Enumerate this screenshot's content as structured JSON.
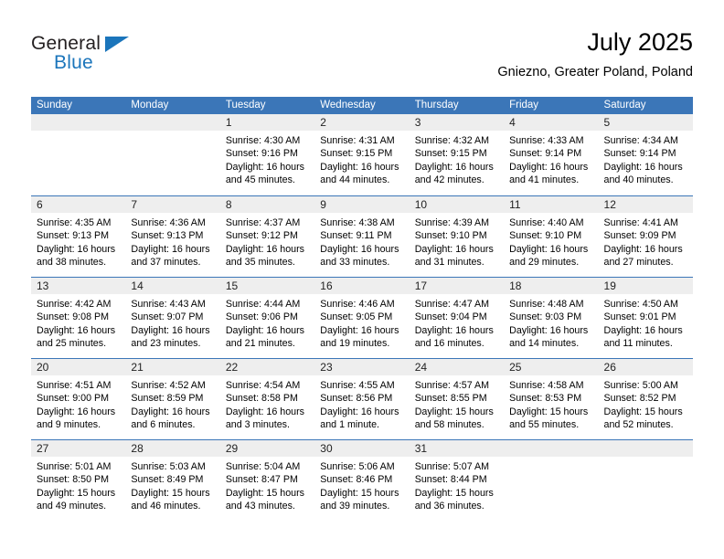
{
  "brand": {
    "name_part1": "General",
    "name_part2": "Blue",
    "logo_icon": "triangle-flag-icon",
    "accent_color": "#1b75bb"
  },
  "header": {
    "title": "July 2025",
    "subtitle": "Gniezno, Greater Poland, Poland"
  },
  "calendar": {
    "header_bg": "#3b76b8",
    "day_band_bg": "#eeeeee",
    "weekday_headers": [
      "Sunday",
      "Monday",
      "Tuesday",
      "Wednesday",
      "Thursday",
      "Friday",
      "Saturday"
    ],
    "weeks": [
      [
        {
          "day": "",
          "lines": []
        },
        {
          "day": "",
          "lines": []
        },
        {
          "day": "1",
          "lines": [
            "Sunrise: 4:30 AM",
            "Sunset: 9:16 PM",
            "Daylight: 16 hours",
            "and 45 minutes."
          ]
        },
        {
          "day": "2",
          "lines": [
            "Sunrise: 4:31 AM",
            "Sunset: 9:15 PM",
            "Daylight: 16 hours",
            "and 44 minutes."
          ]
        },
        {
          "day": "3",
          "lines": [
            "Sunrise: 4:32 AM",
            "Sunset: 9:15 PM",
            "Daylight: 16 hours",
            "and 42 minutes."
          ]
        },
        {
          "day": "4",
          "lines": [
            "Sunrise: 4:33 AM",
            "Sunset: 9:14 PM",
            "Daylight: 16 hours",
            "and 41 minutes."
          ]
        },
        {
          "day": "5",
          "lines": [
            "Sunrise: 4:34 AM",
            "Sunset: 9:14 PM",
            "Daylight: 16 hours",
            "and 40 minutes."
          ]
        }
      ],
      [
        {
          "day": "6",
          "lines": [
            "Sunrise: 4:35 AM",
            "Sunset: 9:13 PM",
            "Daylight: 16 hours",
            "and 38 minutes."
          ]
        },
        {
          "day": "7",
          "lines": [
            "Sunrise: 4:36 AM",
            "Sunset: 9:13 PM",
            "Daylight: 16 hours",
            "and 37 minutes."
          ]
        },
        {
          "day": "8",
          "lines": [
            "Sunrise: 4:37 AM",
            "Sunset: 9:12 PM",
            "Daylight: 16 hours",
            "and 35 minutes."
          ]
        },
        {
          "day": "9",
          "lines": [
            "Sunrise: 4:38 AM",
            "Sunset: 9:11 PM",
            "Daylight: 16 hours",
            "and 33 minutes."
          ]
        },
        {
          "day": "10",
          "lines": [
            "Sunrise: 4:39 AM",
            "Sunset: 9:10 PM",
            "Daylight: 16 hours",
            "and 31 minutes."
          ]
        },
        {
          "day": "11",
          "lines": [
            "Sunrise: 4:40 AM",
            "Sunset: 9:10 PM",
            "Daylight: 16 hours",
            "and 29 minutes."
          ]
        },
        {
          "day": "12",
          "lines": [
            "Sunrise: 4:41 AM",
            "Sunset: 9:09 PM",
            "Daylight: 16 hours",
            "and 27 minutes."
          ]
        }
      ],
      [
        {
          "day": "13",
          "lines": [
            "Sunrise: 4:42 AM",
            "Sunset: 9:08 PM",
            "Daylight: 16 hours",
            "and 25 minutes."
          ]
        },
        {
          "day": "14",
          "lines": [
            "Sunrise: 4:43 AM",
            "Sunset: 9:07 PM",
            "Daylight: 16 hours",
            "and 23 minutes."
          ]
        },
        {
          "day": "15",
          "lines": [
            "Sunrise: 4:44 AM",
            "Sunset: 9:06 PM",
            "Daylight: 16 hours",
            "and 21 minutes."
          ]
        },
        {
          "day": "16",
          "lines": [
            "Sunrise: 4:46 AM",
            "Sunset: 9:05 PM",
            "Daylight: 16 hours",
            "and 19 minutes."
          ]
        },
        {
          "day": "17",
          "lines": [
            "Sunrise: 4:47 AM",
            "Sunset: 9:04 PM",
            "Daylight: 16 hours",
            "and 16 minutes."
          ]
        },
        {
          "day": "18",
          "lines": [
            "Sunrise: 4:48 AM",
            "Sunset: 9:03 PM",
            "Daylight: 16 hours",
            "and 14 minutes."
          ]
        },
        {
          "day": "19",
          "lines": [
            "Sunrise: 4:50 AM",
            "Sunset: 9:01 PM",
            "Daylight: 16 hours",
            "and 11 minutes."
          ]
        }
      ],
      [
        {
          "day": "20",
          "lines": [
            "Sunrise: 4:51 AM",
            "Sunset: 9:00 PM",
            "Daylight: 16 hours",
            "and 9 minutes."
          ]
        },
        {
          "day": "21",
          "lines": [
            "Sunrise: 4:52 AM",
            "Sunset: 8:59 PM",
            "Daylight: 16 hours",
            "and 6 minutes."
          ]
        },
        {
          "day": "22",
          "lines": [
            "Sunrise: 4:54 AM",
            "Sunset: 8:58 PM",
            "Daylight: 16 hours",
            "and 3 minutes."
          ]
        },
        {
          "day": "23",
          "lines": [
            "Sunrise: 4:55 AM",
            "Sunset: 8:56 PM",
            "Daylight: 16 hours",
            "and 1 minute."
          ]
        },
        {
          "day": "24",
          "lines": [
            "Sunrise: 4:57 AM",
            "Sunset: 8:55 PM",
            "Daylight: 15 hours",
            "and 58 minutes."
          ]
        },
        {
          "day": "25",
          "lines": [
            "Sunrise: 4:58 AM",
            "Sunset: 8:53 PM",
            "Daylight: 15 hours",
            "and 55 minutes."
          ]
        },
        {
          "day": "26",
          "lines": [
            "Sunrise: 5:00 AM",
            "Sunset: 8:52 PM",
            "Daylight: 15 hours",
            "and 52 minutes."
          ]
        }
      ],
      [
        {
          "day": "27",
          "lines": [
            "Sunrise: 5:01 AM",
            "Sunset: 8:50 PM",
            "Daylight: 15 hours",
            "and 49 minutes."
          ]
        },
        {
          "day": "28",
          "lines": [
            "Sunrise: 5:03 AM",
            "Sunset: 8:49 PM",
            "Daylight: 15 hours",
            "and 46 minutes."
          ]
        },
        {
          "day": "29",
          "lines": [
            "Sunrise: 5:04 AM",
            "Sunset: 8:47 PM",
            "Daylight: 15 hours",
            "and 43 minutes."
          ]
        },
        {
          "day": "30",
          "lines": [
            "Sunrise: 5:06 AM",
            "Sunset: 8:46 PM",
            "Daylight: 15 hours",
            "and 39 minutes."
          ]
        },
        {
          "day": "31",
          "lines": [
            "Sunrise: 5:07 AM",
            "Sunset: 8:44 PM",
            "Daylight: 15 hours",
            "and 36 minutes."
          ]
        },
        {
          "day": "",
          "lines": []
        },
        {
          "day": "",
          "lines": []
        }
      ]
    ]
  }
}
